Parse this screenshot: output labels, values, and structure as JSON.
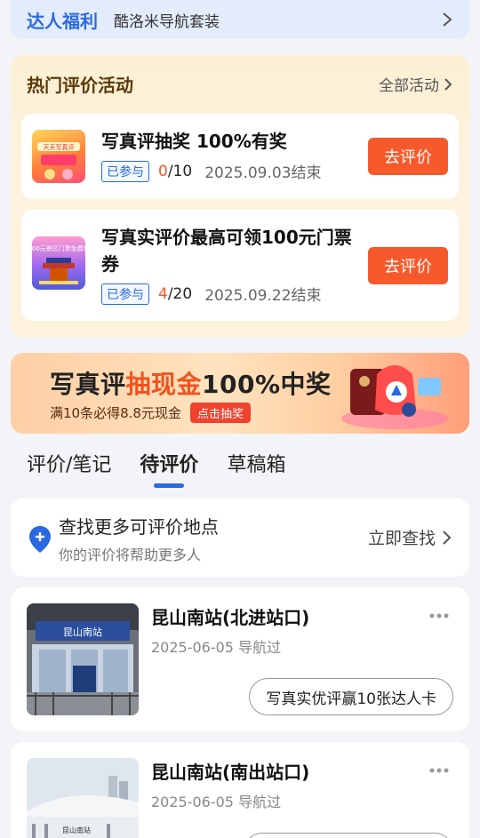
{
  "top_banner": {
    "title": "达人福利",
    "subtitle": "酷洛米导航套装"
  },
  "activities": {
    "title": "热门评价活动",
    "all_label": "全部活动",
    "items": [
      {
        "title": "写真评抽奖 100%有奖",
        "badge": "已参与",
        "done": "0",
        "total": "/10",
        "end": "2025.09.03结束",
        "button": "去评价",
        "thumb_text": "天天写真评"
      },
      {
        "title_line1": "写真实评价最高可领100元门票",
        "title_line2": "券",
        "badge": "已参与",
        "done": "4",
        "total": "/20",
        "end": "2025.09.22结束",
        "button": "去评价",
        "thumb_text": "100元景区门票免费领"
      }
    ]
  },
  "promo": {
    "prefix": "写真评",
    "highlight": "抽现金",
    "suffix": "100%中奖",
    "subtitle": "满10条必得8.8元现金",
    "button": "点击抽奖"
  },
  "tabs": [
    "评价/笔记",
    "待评价",
    "草稿箱"
  ],
  "find": {
    "title": "查找更多可评价地点",
    "subtitle": "你的评价将帮助更多人",
    "action": "立即查找"
  },
  "places": [
    {
      "name": "昆山南站(北进站口)",
      "date": "2025-06-05 导航过",
      "button": "写真实优评赢10张达人卡",
      "sign": "昆山南站"
    },
    {
      "name": "昆山南站(南出站口)",
      "date": "2025-06-05 导航过",
      "sign": "昆山南站"
    }
  ],
  "colors": {
    "accent": "#2a6ae0",
    "cta": "#f65a2c"
  }
}
